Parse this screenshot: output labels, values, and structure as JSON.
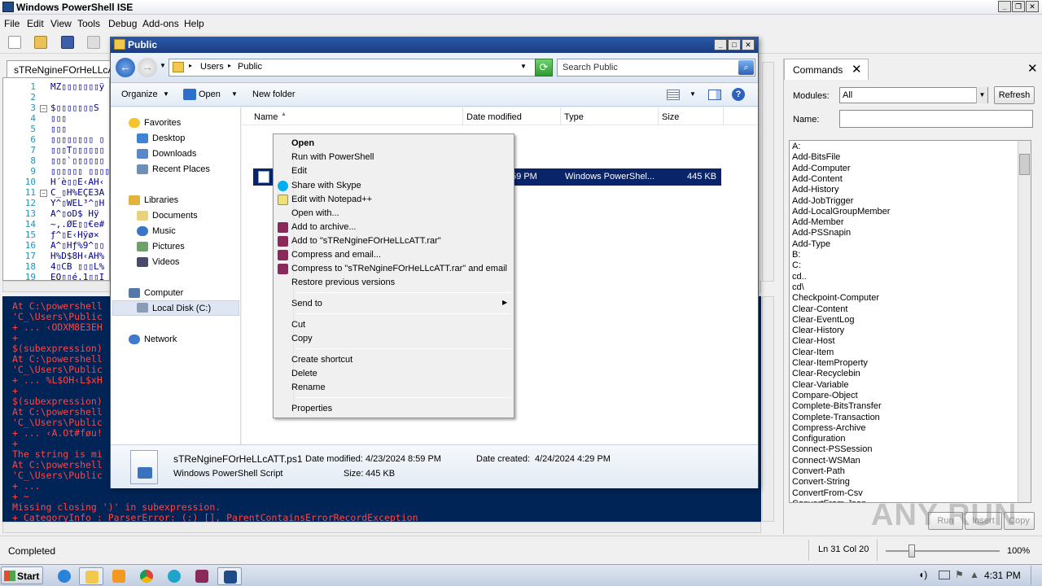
{
  "ise": {
    "title": "Windows PowerShell ISE",
    "menu": [
      "File",
      "Edit",
      "View",
      "Tools",
      "Debug",
      "Add-ons",
      "Help"
    ],
    "tab_title": "sTReNgineFOrHeLLcATT.ps1",
    "line_numbers": [
      "1",
      "2",
      "3",
      "4",
      "5",
      "6",
      "7",
      "8",
      "9",
      "10",
      "11",
      "12",
      "13",
      "14",
      "15",
      "16",
      "17",
      "18",
      "19"
    ],
    "code_lines": [
      "MZ▯▯▯▯▯▯▯ÿ",
      "",
      "$▯▯▯▯▯▯▯S",
      "▯▯▯",
      "▯▯▯",
      "▯▯▯▯▯▯▯▯ ▯",
      "▯▯▯T▯▯▯▯▯▯",
      "▯▯▯`▯▯▯▯▯▯",
      "▯▯▯▯▯▯ ▯▯▯▯",
      "H´è▯▯E‹AH‹",
      "C_▯H%EÇE3A",
      "Y^▯WEL³^▯H",
      "A^▯oD$ Hÿ",
      "~,.ØE▯▯€e#",
      "ƒ^▯E‹Hÿø×",
      "A^▯Hƒ%9^▯▯",
      "H%D$8H‹AH%",
      "4▯CB ▯▯▯L%",
      "EQ▯▯é.1▯▯I"
    ],
    "console_lines": [
      "At C:\\powershell",
      "'C_\\Users\\Public",
      "+ ... ‹ODXM8E3EH",
      "+",
      "$(subexpression)",
      "At C:\\powershell",
      "'C_\\Users\\Public",
      "+ ... %L$OH‹L$xH",
      "+",
      "$(subexpression)",
      "At C:\\powershell",
      "'C_\\Users\\Public",
      "+ ... ‹A.Ot#føu!",
      "+",
      "The string is mi",
      "At C:\\powershell",
      "'C_\\Users\\Public",
      "+ ...",
      "+                                                          ~",
      "Missing closing ')' in subexpression.",
      "    + CategoryInfo          : ParserError: (:) [], ParentContainsErrorRecordException"
    ],
    "status": "Completed",
    "ln_col": "Ln 31  Col 20",
    "zoom": "100%"
  },
  "commands": {
    "title": "Commands",
    "modules_label": "Modules:",
    "modules_value": "All",
    "refresh_label": "Refresh",
    "name_label": "Name:",
    "name_value": "",
    "items": [
      "A:",
      "Add-BitsFile",
      "Add-Computer",
      "Add-Content",
      "Add-History",
      "Add-JobTrigger",
      "Add-LocalGroupMember",
      "Add-Member",
      "Add-PSSnapin",
      "Add-Type",
      "B:",
      "C:",
      "cd..",
      "cd\\",
      "Checkpoint-Computer",
      "Clear-Content",
      "Clear-EventLog",
      "Clear-History",
      "Clear-Host",
      "Clear-Item",
      "Clear-ItemProperty",
      "Clear-Recyclebin",
      "Clear-Variable",
      "Compare-Object",
      "Complete-BitsTransfer",
      "Complete-Transaction",
      "Compress-Archive",
      "Configuration",
      "Connect-PSSession",
      "Connect-WSMan",
      "Convert-Path",
      "Convert-String",
      "ConvertFrom-Csv",
      "ConvertFrom-Json"
    ],
    "run_label": "Run",
    "insert_label": "Insert",
    "copy_label": "Copy"
  },
  "explorer": {
    "title": "Public",
    "breadcrumb": [
      "Users",
      "Public"
    ],
    "search_placeholder": "Search Public",
    "toolbar": {
      "organize": "Organize",
      "open": "Open",
      "new_folder": "New folder"
    },
    "nav": {
      "favorites": "Favorites",
      "favorites_items": [
        "Desktop",
        "Downloads",
        "Recent Places"
      ],
      "libraries": "Libraries",
      "libraries_items": [
        "Documents",
        "Music",
        "Pictures",
        "Videos"
      ],
      "computer": "Computer",
      "local_disk": "Local Disk (C:)",
      "network": "Network"
    },
    "columns": [
      "Name",
      "Date modified",
      "Type",
      "Size"
    ],
    "file": {
      "date_visible": ":59 PM",
      "type": "Windows PowerShel...",
      "size": "445 KB"
    },
    "details": {
      "name": "sTReNgineFOrHeLLcATT.ps1",
      "date_modified_label": "Date modified:",
      "date_modified": "4/23/2024 8:59 PM",
      "date_created_label": "Date created:",
      "date_created": "4/24/2024 4:29 PM",
      "type": "Windows PowerShell Script",
      "size_label": "Size:",
      "size": "445 KB"
    }
  },
  "context_menu": {
    "group1": [
      "Open",
      "Run with PowerShell",
      "Edit",
      "Share with Skype",
      "Edit with Notepad++",
      "Open with...",
      "Add to archive...",
      "Add to \"sTReNgineFOrHeLLcATT.rar\"",
      "Compress and email...",
      "Compress to \"sTReNgineFOrHeLLcATT.rar\" and email",
      "Restore previous versions"
    ],
    "group2": [
      "Send to"
    ],
    "group3": [
      "Cut",
      "Copy"
    ],
    "group4": [
      "Create shortcut",
      "Delete",
      "Rename"
    ],
    "group5": [
      "Properties"
    ]
  },
  "taskbar": {
    "start": "Start",
    "time": "4:31 PM"
  },
  "watermark": "ANY RUN",
  "colors": {
    "console_bg": "#012456",
    "console_error": "#ff4646",
    "explorer_title": "#1a3d82",
    "selection": "#0a246a"
  }
}
